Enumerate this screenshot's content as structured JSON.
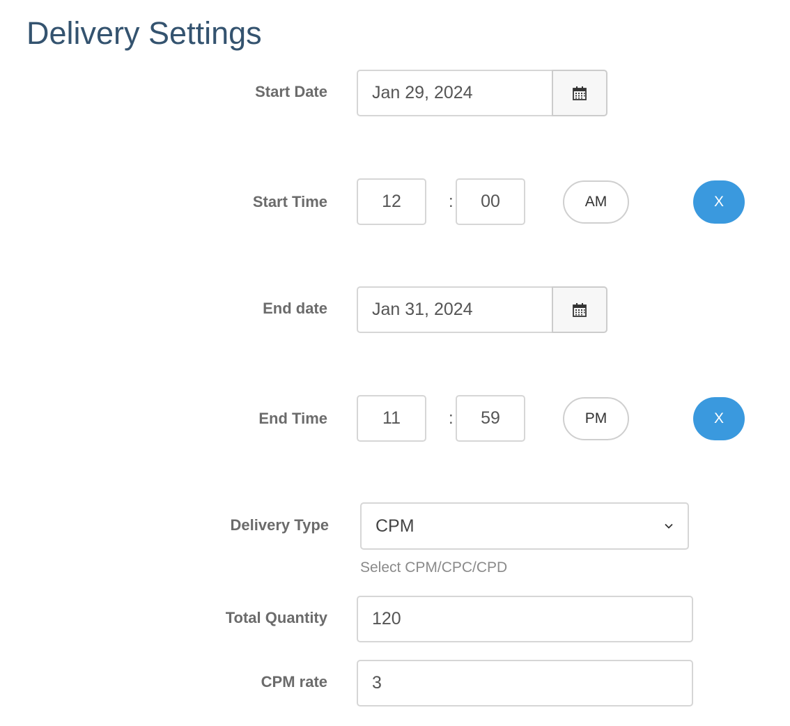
{
  "title": "Delivery Settings",
  "start_date": {
    "label": "Start Date",
    "value": "Jan 29, 2024",
    "calendar_icon": "calendar-icon"
  },
  "start_time": {
    "label": "Start Time",
    "hour": "12",
    "separator": ":",
    "minute": "00",
    "period": "AM",
    "clear_label": "X"
  },
  "end_date": {
    "label": "End date",
    "value": "Jan 31, 2024",
    "calendar_icon": "calendar-icon"
  },
  "end_time": {
    "label": "End Time",
    "hour": "11",
    "separator": ":",
    "minute": "59",
    "period": "PM",
    "clear_label": "X"
  },
  "delivery_type": {
    "label": "Delivery Type",
    "value": "CPM",
    "help": "Select CPM/CPC/CPD"
  },
  "total_quantity": {
    "label": "Total Quantity",
    "value": "120"
  },
  "cpm_rate": {
    "label": "CPM rate",
    "value": "3"
  },
  "colors": {
    "title": "#34536f",
    "accent": "#3a99de",
    "label": "#6b6b6b",
    "border": "#d6d6d6"
  }
}
